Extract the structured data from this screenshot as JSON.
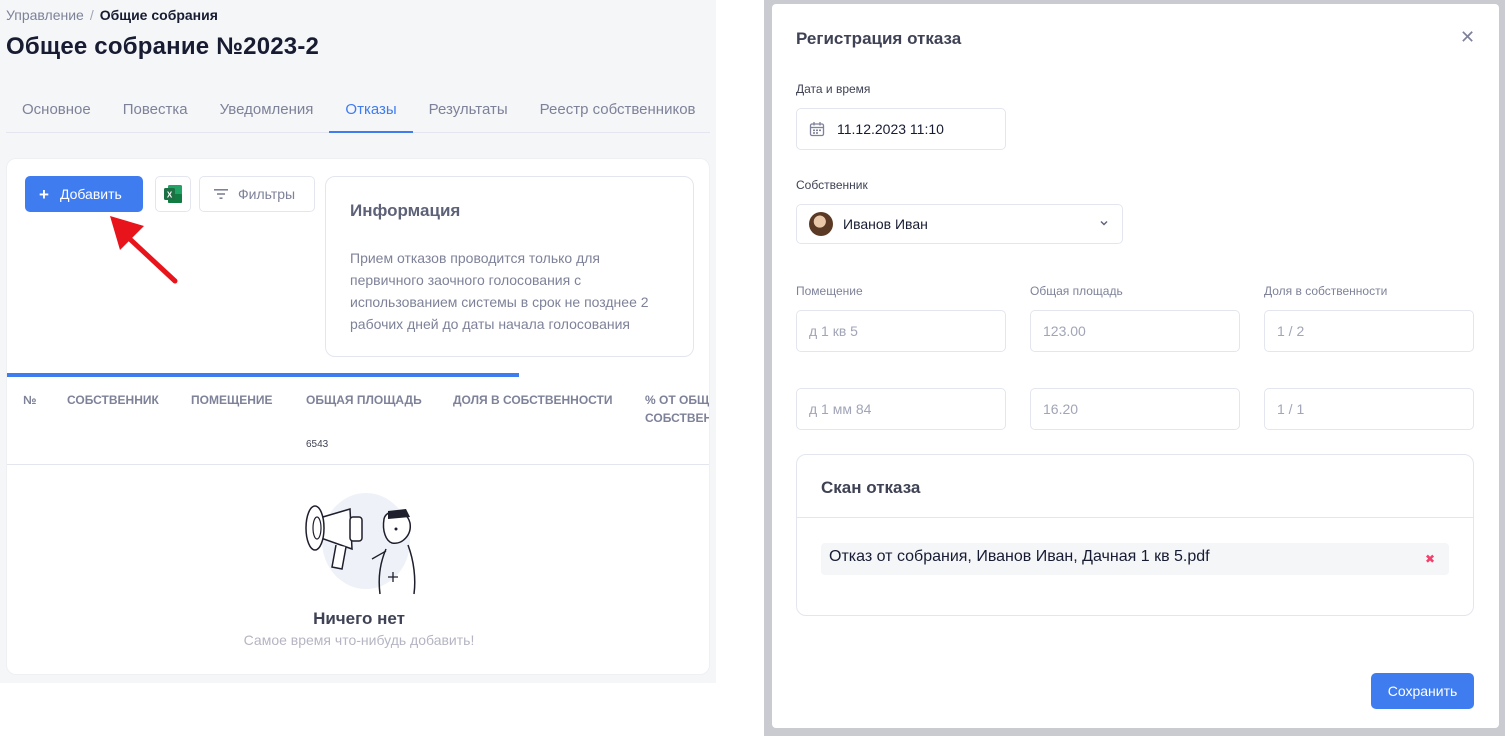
{
  "breadcrumb": {
    "parent": "Управление",
    "separator": "/",
    "current": "Общие собрания"
  },
  "page_title": "Общее собрание №2023-2",
  "tabs": [
    {
      "label": "Основное",
      "active": false
    },
    {
      "label": "Повестка",
      "active": false
    },
    {
      "label": "Уведомления",
      "active": false
    },
    {
      "label": "Отказы",
      "active": true
    },
    {
      "label": "Результаты",
      "active": false
    },
    {
      "label": "Реестр собственников",
      "active": false
    }
  ],
  "toolbar": {
    "add_label": "Добавить",
    "excel_icon": "excel-icon",
    "filter_label": "Фильтры"
  },
  "info": {
    "title": "Информация",
    "text": "Прием отказов проводится только для первичного заочного голосования с использованием системы в срок не позднее 2 рабочих дней до даты начала голосования"
  },
  "table": {
    "progress": 0.73,
    "columns": [
      "№",
      "Собственник",
      "Помещение",
      "Общая площадь",
      "Доля в собственности",
      "% от общ",
      "собствен"
    ],
    "area_total": "6543"
  },
  "empty_state": {
    "title": "Ничего нет",
    "subtitle": "Самое время что-нибудь добавить!"
  },
  "modal": {
    "title": "Регистрация отказа",
    "close_icon": "close-icon",
    "datetime_label": "Дата и время",
    "datetime_value": "11.12.2023 11:10",
    "owner_label": "Собственник",
    "owner_value": "Иванов Иван",
    "col_room": "Помещение",
    "col_area": "Общая площадь",
    "col_share": "Доля в собственности",
    "rows": [
      {
        "room": "д 1 кв 5",
        "area": "123.00",
        "share": "1 / 2"
      },
      {
        "room": "д 1 мм 84",
        "area": "16.20",
        "share": "1 / 1"
      }
    ],
    "scan_title": "Скан отказа",
    "file_name": "Отказ от собрания, Иванов Иван, Дачная 1 кв 5.pdf",
    "save_label": "Сохранить"
  },
  "colors": {
    "accent": "#3e7cf0",
    "danger": "#f1416c",
    "excel": "#1d7044",
    "annotation_arrow": "#e8141b"
  }
}
